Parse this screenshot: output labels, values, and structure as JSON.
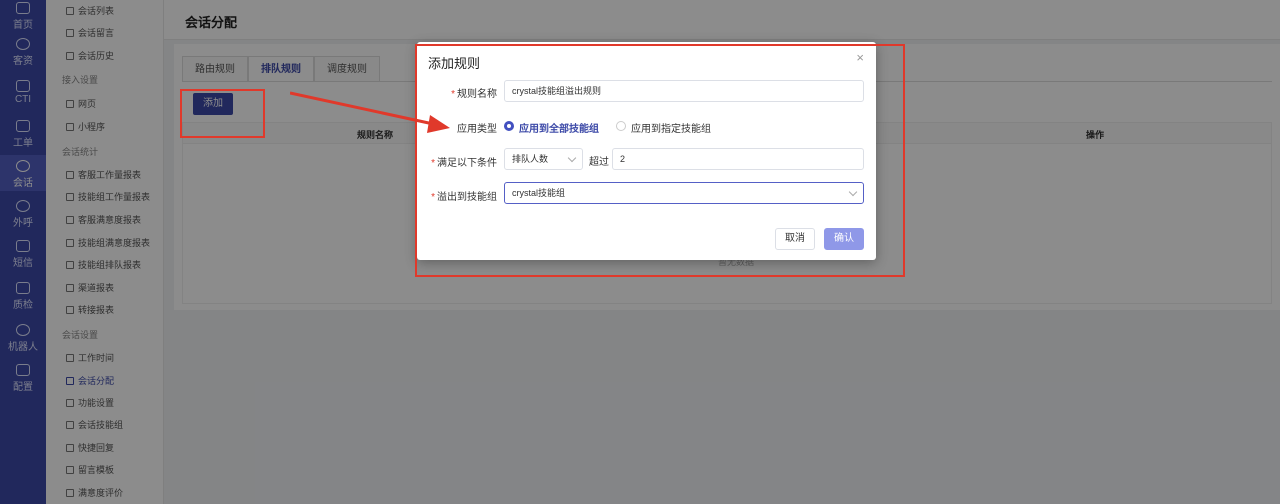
{
  "nav": {
    "items": [
      {
        "label": "首页",
        "icon": "home-icon"
      },
      {
        "label": "客资",
        "icon": "users-icon"
      },
      {
        "label": "CTI",
        "icon": "cti-icon"
      },
      {
        "label": "工单",
        "icon": "ticket-icon"
      },
      {
        "label": "会话",
        "icon": "chat-icon"
      },
      {
        "label": "外呼",
        "icon": "phone-icon"
      },
      {
        "label": "短信",
        "icon": "sms-icon"
      },
      {
        "label": "质检",
        "icon": "quality-icon"
      },
      {
        "label": "机器人",
        "icon": "robot-icon"
      },
      {
        "label": "配置",
        "icon": "config-icon"
      }
    ]
  },
  "menu": {
    "items": [
      {
        "label": "会话列表",
        "type": "item"
      },
      {
        "label": "会话留言",
        "type": "item"
      },
      {
        "label": "会话历史",
        "type": "item"
      },
      {
        "label": "接入设置",
        "type": "group"
      },
      {
        "label": "网页",
        "type": "item"
      },
      {
        "label": "小程序",
        "type": "item"
      },
      {
        "label": "会话统计",
        "type": "group"
      },
      {
        "label": "客服工作量报表",
        "type": "item"
      },
      {
        "label": "技能组工作量报表",
        "type": "item"
      },
      {
        "label": "客服满意度报表",
        "type": "item"
      },
      {
        "label": "技能组满意度报表",
        "type": "item"
      },
      {
        "label": "技能组排队报表",
        "type": "item"
      },
      {
        "label": "渠道报表",
        "type": "item"
      },
      {
        "label": "转接报表",
        "type": "item"
      },
      {
        "label": "会话设置",
        "type": "group"
      },
      {
        "label": "工作时间",
        "type": "item"
      },
      {
        "label": "会话分配",
        "type": "item",
        "active": true
      },
      {
        "label": "功能设置",
        "type": "item"
      },
      {
        "label": "会话技能组",
        "type": "item"
      },
      {
        "label": "快捷回复",
        "type": "item"
      },
      {
        "label": "留言模板",
        "type": "item"
      },
      {
        "label": "满意度评价",
        "type": "item"
      }
    ]
  },
  "header": {
    "title": "会话分配"
  },
  "tabs": [
    {
      "label": "路由规则"
    },
    {
      "label": "排队规则"
    },
    {
      "label": "调度规则"
    }
  ],
  "toolbar": {
    "add_label": "添加"
  },
  "table": {
    "columns": [
      "规则名称",
      "操作"
    ],
    "empty_text": "暂无数据"
  },
  "modal": {
    "title": "添加规则",
    "close_glyph": "×",
    "rule_name": {
      "label": "规则名称",
      "value": "crystal技能组溢出规则"
    },
    "apply_type": {
      "label": "应用类型",
      "options": [
        "应用到全部技能组",
        "应用到指定技能组"
      ],
      "selected": 0
    },
    "condition": {
      "label": "满足以下条件",
      "select_value": "排队人数",
      "connector": "超过",
      "threshold": "2"
    },
    "overflow": {
      "label": "溢出到技能组",
      "value": "crystal技能组"
    },
    "cancel_label": "取消",
    "confirm_label": "确认"
  },
  "colors": {
    "primary": "#3d4aa8",
    "annotation": "#e0392b",
    "confirm": "#8f98e8"
  }
}
